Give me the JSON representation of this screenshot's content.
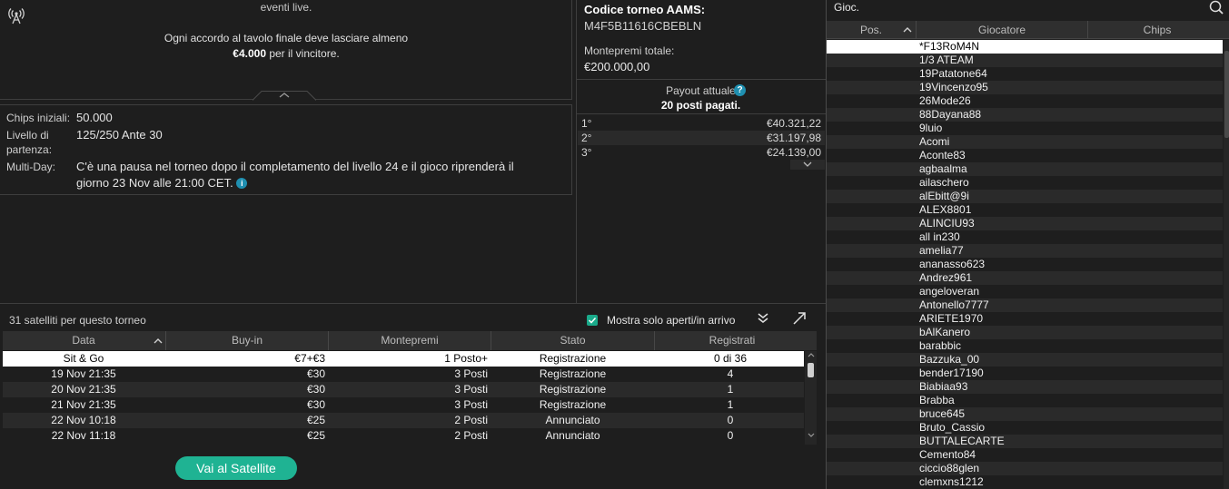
{
  "info": {
    "line1": "eventi live.",
    "line2": "Ogni accordo al tavolo finale deve lasciare almeno",
    "line3_amount": "€4.000",
    "line3_rest": " per il vincitore."
  },
  "details": {
    "chips_label": "Chips iniziali:",
    "chips_value": "50.000",
    "level_label_1": "Livello di",
    "level_label_2": "partenza:",
    "level_value": "125/250 Ante 30",
    "multiday_label": "Multi-Day:",
    "multiday_line1": "C'è una pausa nel torneo dopo il completamento del livello 24 e il gioco riprenderà il",
    "multiday_line2": "giorno 23 Nov alle 21:00 CET."
  },
  "center": {
    "aams_title": "Codice torneo AAMS:",
    "aams_code": "M4F5B11616CBEBLN",
    "prize_label": "Montepremi totale:",
    "prize_value": "€200.000,00",
    "payout_label": "Payout attuale",
    "payout_help": "?",
    "payout_sub": "20 posti pagati.",
    "payouts": [
      {
        "pos": "1°",
        "amount": "€40.321,22"
      },
      {
        "pos": "2°",
        "amount": "€31.197,98"
      },
      {
        "pos": "3°",
        "amount": "€24.139,00"
      }
    ]
  },
  "players": {
    "title": "Gioc.",
    "col_pos": "Pos.",
    "col_player": "Giocatore",
    "col_chips": "Chips",
    "list": [
      "*F13RoM4N",
      "1/3 ATEAM",
      "19Patatone64",
      "19Vincenzo95",
      "26Mode26",
      "88Dayana88",
      "9luio",
      "Acomi",
      "Aconte83",
      "agbaalma",
      "ailaschero",
      "alEbitt@9i",
      "ALEX8801",
      "ALINCIU93",
      "all in230",
      "amelia77",
      "ananasso623",
      "Andrez961",
      "angeloveran",
      "Antonello7777",
      "ARIETE1970",
      "bAlKanero",
      "barabbic",
      "Bazzuka_00",
      "bender17190",
      "Biabiaa93",
      "Brabba",
      "bruce645",
      "Bruto_Cassio",
      "BUTTALECARTE",
      "Cemento84",
      "ciccio88glen",
      "clemxns1212"
    ]
  },
  "satellites": {
    "title": "31 satelliti per questo torneo",
    "filter_label": "Mostra solo aperti/in arrivo",
    "col_date": "Data",
    "col_buyin": "Buy-in",
    "col_prize": "Montepremi",
    "col_status": "Stato",
    "col_registered": "Registrati",
    "rows": [
      {
        "date": "Sit & Go",
        "buyin": "€7+€3",
        "prize": "1 Posto+",
        "status": "Registrazione",
        "registered": "0 di 36"
      },
      {
        "date": "19 Nov  21:35",
        "buyin": "€30",
        "prize": "3 Posti",
        "status": "Registrazione",
        "registered": "4"
      },
      {
        "date": "20 Nov  21:35",
        "buyin": "€30",
        "prize": "3 Posti",
        "status": "Registrazione",
        "registered": "1"
      },
      {
        "date": "21 Nov  21:35",
        "buyin": "€30",
        "prize": "3 Posti",
        "status": "Registrazione",
        "registered": "1"
      },
      {
        "date": "22 Nov  10:18",
        "buyin": "€25",
        "prize": "2 Posti",
        "status": "Annunciato",
        "registered": "0"
      },
      {
        "date": "22 Nov  11:18",
        "buyin": "€25",
        "prize": "2 Posti",
        "status": "Annunciato",
        "registered": "0"
      }
    ],
    "button_label": "Vai al Satellite"
  }
}
